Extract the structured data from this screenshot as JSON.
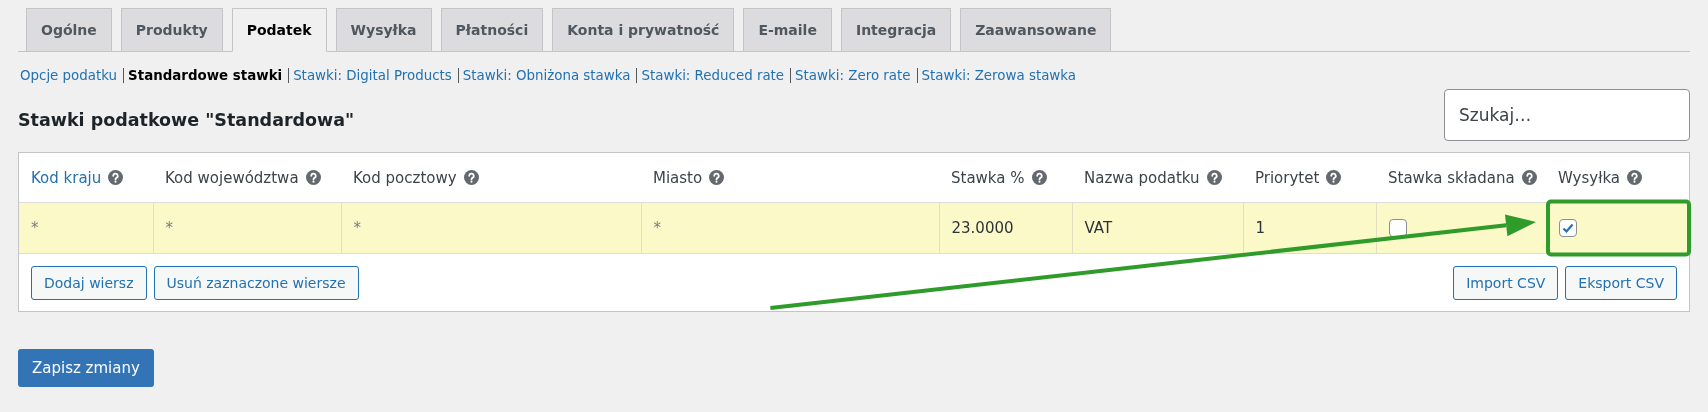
{
  "tabs": [
    {
      "label": "Ogólne",
      "selected": false
    },
    {
      "label": "Produkty",
      "selected": false
    },
    {
      "label": "Podatek",
      "selected": true
    },
    {
      "label": "Wysyłka",
      "selected": false
    },
    {
      "label": "Płatności",
      "selected": false
    },
    {
      "label": "Konta i prywatność",
      "selected": false
    },
    {
      "label": "E-maile",
      "selected": false
    },
    {
      "label": "Integracja",
      "selected": false
    },
    {
      "label": "Zaawansowane",
      "selected": false
    }
  ],
  "subnav": [
    {
      "label": "Opcje podatku",
      "selected": false
    },
    {
      "label": "Standardowe stawki",
      "selected": true
    },
    {
      "label": "Stawki: Digital Products",
      "selected": false
    },
    {
      "label": "Stawki: Obniżona stawka",
      "selected": false
    },
    {
      "label": "Stawki: Reduced rate",
      "selected": false
    },
    {
      "label": "Stawki: Zero rate",
      "selected": false
    },
    {
      "label": "Stawki: Zerowa stawka",
      "selected": false
    }
  ],
  "heading": "Stawki podatkowe \"Standardowa\"",
  "search": {
    "placeholder": "Szukaj…"
  },
  "table": {
    "columns": [
      {
        "label": "Kod kraju",
        "link": true,
        "highlighted": false
      },
      {
        "label": "Kod województwa",
        "link": false,
        "highlighted": false
      },
      {
        "label": "Kod pocztowy",
        "link": false,
        "highlighted": false
      },
      {
        "label": "Miasto",
        "link": false,
        "highlighted": false
      },
      {
        "label": "Stawka %",
        "link": false,
        "highlighted": false
      },
      {
        "label": "Nazwa podatku",
        "link": false,
        "highlighted": false
      },
      {
        "label": "Priorytet",
        "link": false,
        "highlighted": false
      },
      {
        "label": "Stawka składana",
        "link": false,
        "highlighted": false
      },
      {
        "label": "Wysyłka",
        "link": false,
        "highlighted": true
      }
    ],
    "rows": [
      {
        "cells": [
          {
            "kind": "text",
            "value": "*",
            "placeholder": true
          },
          {
            "kind": "text",
            "value": "*",
            "placeholder": true
          },
          {
            "kind": "text",
            "value": "*",
            "placeholder": true
          },
          {
            "kind": "text",
            "value": "*",
            "placeholder": true
          },
          {
            "kind": "text",
            "value": "23.0000",
            "placeholder": false
          },
          {
            "kind": "text",
            "value": "VAT",
            "placeholder": false
          },
          {
            "kind": "text",
            "value": "1",
            "placeholder": false
          },
          {
            "kind": "checkbox",
            "checked": false
          },
          {
            "kind": "checkbox",
            "checked": true
          }
        ]
      }
    ],
    "left_buttons": [
      "Dodaj wiersz",
      "Usuń zaznaczone wiersze"
    ],
    "right_buttons": [
      "Import CSV",
      "Eksport CSV"
    ]
  },
  "save_button": "Zapisz zmiany"
}
